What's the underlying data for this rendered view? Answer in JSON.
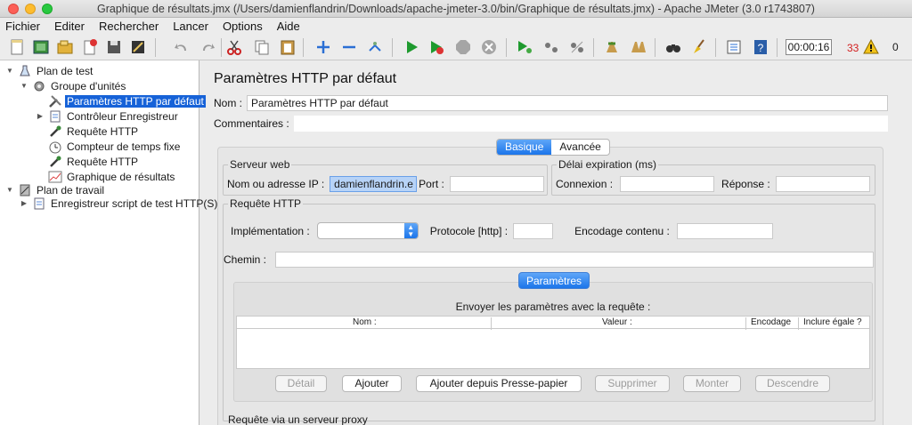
{
  "window": {
    "title": "Graphique de résultats.jmx (/Users/damienflandrin/Downloads/apache-jmeter-3.0/bin/Graphique de résultats.jmx) - Apache JMeter (3.0 r1743807)"
  },
  "menu": [
    "Fichier",
    "Editer",
    "Rechercher",
    "Lancer",
    "Options",
    "Aide"
  ],
  "toolbar": {
    "timer": "00:00:16",
    "error_count": "33",
    "tree_counter": "0"
  },
  "tree": {
    "nodes": [
      {
        "label": "Plan de test",
        "icon": "flask-icon"
      },
      {
        "label": "Groupe d'unités",
        "icon": "gear-icon"
      },
      {
        "label": "Paramètres HTTP par défaut",
        "icon": "wrench-icon"
      },
      {
        "label": "Contrôleur Enregistreur",
        "icon": "document-icon"
      },
      {
        "label": "Requête HTTP",
        "icon": "pipette-icon"
      },
      {
        "label": "Compteur de temps fixe",
        "icon": "stopwatch-icon"
      },
      {
        "label": "Requête HTTP",
        "icon": "pipette-icon"
      },
      {
        "label": "Graphique de résultats",
        "icon": "chart-icon"
      },
      {
        "label": "Plan de travail",
        "icon": "clipboard-icon"
      },
      {
        "label": "Enregistreur script de test HTTP(S)",
        "icon": "document-icon"
      }
    ]
  },
  "panel": {
    "title": "Paramètres HTTP par défaut",
    "name_label": "Nom :",
    "name_value": "Paramètres HTTP par défaut",
    "comments_label": "Commentaires :",
    "tabs": [
      "Basique",
      "Avancée"
    ],
    "server": {
      "title": "Serveur web",
      "host_label": "Nom ou adresse IP :",
      "host_value": "damienflandrin.e",
      "port_label": "Port :"
    },
    "timeout": {
      "title": "Délai expiration (ms)",
      "connect_label": "Connexion :",
      "response_label": "Réponse :"
    },
    "http": {
      "title": "Requête HTTP",
      "impl_label": "Implémentation :",
      "protocol_label": "Protocole [http] :",
      "encoding_label": "Encodage contenu :",
      "path_label": "Chemin :"
    },
    "params": {
      "tab": "Paramètres",
      "caption": "Envoyer les paramètres avec la requête :",
      "columns": [
        "Nom :",
        "Valeur :",
        "Encodage",
        "Inclure égale ?"
      ],
      "buttons": [
        "Détail",
        "Ajouter",
        "Ajouter depuis Presse-papier",
        "Supprimer",
        "Monter",
        "Descendre"
      ]
    },
    "proxy_title": "Requête via un serveur proxy"
  },
  "colors": {
    "selection": "#1662d8",
    "accent": "#1b75ea",
    "error": "#d32020"
  }
}
